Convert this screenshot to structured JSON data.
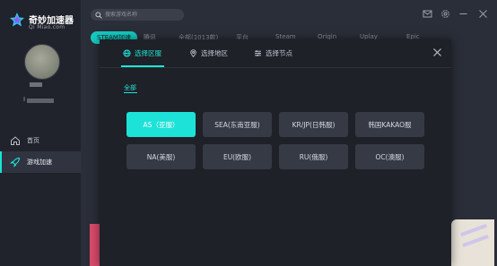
{
  "app": {
    "name": "奇妙加速器",
    "url": "Qi Miao.com"
  },
  "user": {
    "id_label": "I"
  },
  "nav": {
    "home_label": "首页",
    "speedup_label": "游戏加速"
  },
  "search": {
    "placeholder": "搜索游戏名称"
  },
  "tabs": [
    {
      "label": "STEAM加速"
    },
    {
      "label": "腾讯"
    },
    {
      "label": "全部(1013款)"
    },
    {
      "label": "平台"
    },
    {
      "label": "Steam"
    },
    {
      "label": "Origin"
    },
    {
      "label": "Uplay"
    },
    {
      "label": "Epic"
    }
  ],
  "modal": {
    "tabs": {
      "region": "选择区服",
      "area": "选择地区",
      "node": "选择节点"
    },
    "filter_all": "全部",
    "regions": [
      {
        "label": "AS（亚服）",
        "selected": true
      },
      {
        "label": "SEA(东南亚服)",
        "selected": false
      },
      {
        "label": "KR/JP(日韩服)",
        "selected": false
      },
      {
        "label": "韩国KAKAO服",
        "selected": false
      },
      {
        "label": "NA(美服)",
        "selected": false
      },
      {
        "label": "EU(欧服)",
        "selected": false
      },
      {
        "label": "RU(俄服)",
        "selected": false
      },
      {
        "label": "OC(澳服)",
        "selected": false
      }
    ]
  },
  "colors": {
    "accent": "#1de2d7",
    "background": "#2a2e38",
    "sidebar": "#20232b",
    "modal": "#1e2128",
    "region_button": "#363a44"
  },
  "icons": {
    "logo": "star-logo-icon",
    "home": "home-icon",
    "speedup": "rocket-icon",
    "search": "search-icon",
    "mail": "mail-icon",
    "settings": "gear-icon",
    "minimize": "minimize-icon",
    "close": "close-icon",
    "region_tab": "globe-icon",
    "area_tab": "location-pin-icon",
    "node_tab": "sliders-icon"
  }
}
